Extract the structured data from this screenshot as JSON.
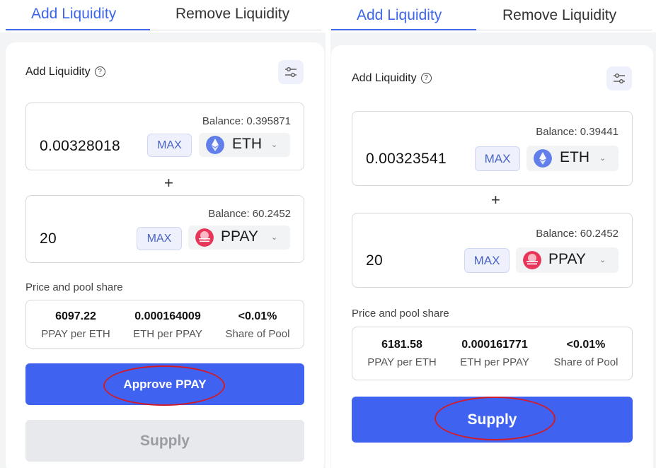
{
  "colors": {
    "accent": "#3d66e8",
    "primary_button": "#3f63f0",
    "annotation_ring": "#d01c2a"
  },
  "left": {
    "tabs": {
      "add": "Add Liquidity",
      "remove": "Remove Liquidity"
    },
    "title": "Add Liquidity",
    "help_glyph": "?",
    "token_a": {
      "balance": "Balance: 0.395871",
      "amount": "0.00328018",
      "max": "MAX",
      "symbol": "ETH",
      "icon": "ethereum-icon"
    },
    "token_b": {
      "balance": "Balance: 60.2452",
      "amount": "20",
      "max": "MAX",
      "symbol": "PPAY",
      "icon": "ppay-icon"
    },
    "plus": "+",
    "pool_label": "Price and pool share",
    "pool": [
      {
        "value": "6097.22",
        "label": "PPAY per ETH"
      },
      {
        "value": "0.000164009",
        "label": "ETH per PPAY"
      },
      {
        "value": "<0.01%",
        "label": "Share of Pool"
      }
    ],
    "approve_button": "Approve PPAY",
    "supply_button": "Supply"
  },
  "right": {
    "tabs": {
      "add": "Add Liquidity",
      "remove": "Remove Liquidity"
    },
    "title": "Add Liquidity",
    "help_glyph": "?",
    "token_a": {
      "balance": "Balance: 0.39441",
      "amount": "0.00323541",
      "max": "MAX",
      "symbol": "ETH",
      "icon": "ethereum-icon"
    },
    "token_b": {
      "balance": "Balance: 60.2452",
      "amount": "20",
      "max": "MAX",
      "symbol": "PPAY",
      "icon": "ppay-icon"
    },
    "plus": "+",
    "pool_label": "Price and pool share",
    "pool": [
      {
        "value": "6181.58",
        "label": "PPAY per ETH"
      },
      {
        "value": "0.000161771",
        "label": "ETH per PPAY"
      },
      {
        "value": "<0.01%",
        "label": "Share of Pool"
      }
    ],
    "supply_button": "Supply"
  }
}
